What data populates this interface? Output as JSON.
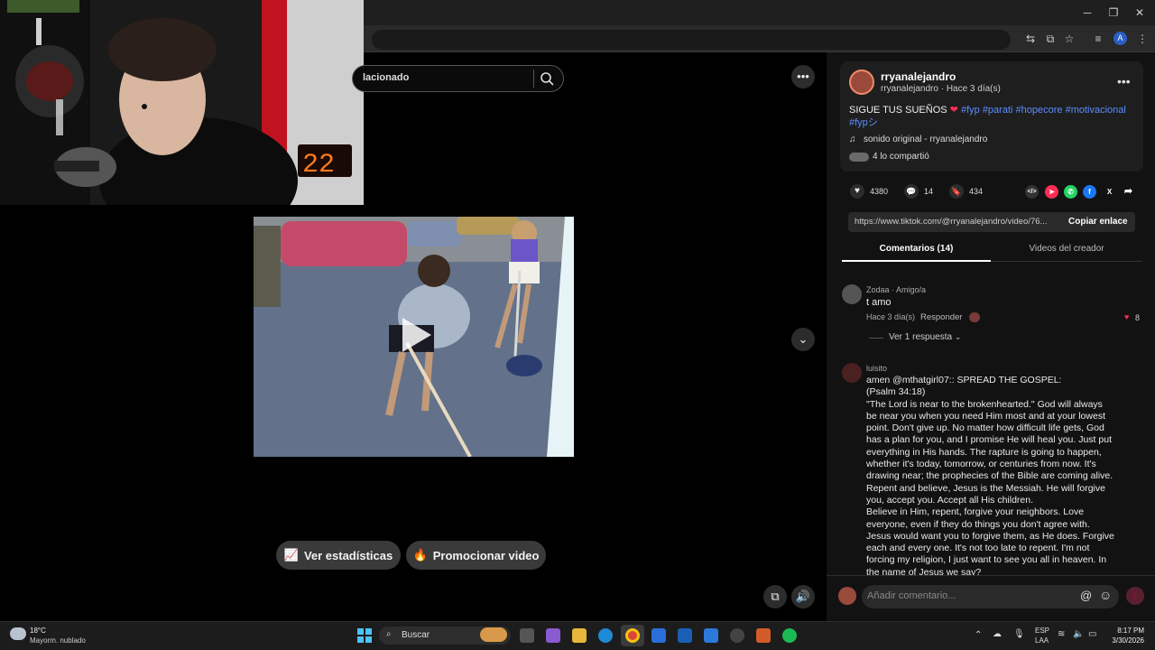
{
  "browser": {
    "window_controls": {
      "minimize": "─",
      "maximize": "❐",
      "close": "✕"
    },
    "profile_initial": "A"
  },
  "webcam": {
    "counter": "22"
  },
  "search": {
    "value": "lacionado"
  },
  "video_actions": {
    "stats_label": "Ver estadísticas",
    "promote_label": "Promocionar video"
  },
  "post": {
    "username": "rryanalejandro",
    "subline": "rryanalejandro · Hace 3 día(s)",
    "caption_text": "SIGUE TUS SUEÑOS",
    "hashtags": [
      "#fyp",
      "#parati",
      "#hopecore",
      "#motivacional",
      "#fypシ"
    ],
    "sound": "sonido original - rryanalejandro",
    "shared": "4 lo compartió"
  },
  "stats": {
    "likes": "4380",
    "comments": "14",
    "saves": "434"
  },
  "link": {
    "url": "https://www.tiktok.com/@rryanalejandro/video/76...",
    "copy_label": "Copiar enlace"
  },
  "tabs": [
    {
      "label": "Comentarios (14)",
      "active": true
    },
    {
      "label": "Videos del creador",
      "active": false
    }
  ],
  "comments": [
    {
      "user": "Zodaa",
      "badge": "Amigo/a",
      "user_line": "Zodaa · Amigo/a",
      "text": "t amo",
      "time": "Hace 3 día(s)",
      "reply_label": "Responder",
      "likes": "8",
      "view_replies": "Ver 1 respuesta"
    },
    {
      "user": "luisito",
      "lines": [
        "amen @mthatgirl07:: SPREAD THE GOSPEL:",
        "(Psalm 34:18)",
        "\"The Lord is near to the brokenhearted.\" God will always",
        "be near you when you need Him most and at your lowest",
        "point. Don't give up. No matter how difficult life gets, God",
        "has a plan for you, and I promise He will heal you. Just put",
        "everything in His hands. The rapture is going to happen,",
        "whether it's today, tomorrow, or centuries from now. It's",
        "drawing near; the prophecies of the Bible are coming alive.",
        "Repent and believe, Jesus is the Messiah. He will forgive",
        "you, accept you. Accept all His children.",
        "Believe in Him, repent, forgive your neighbors. Love",
        "everyone, even if they do things you don't agree with.",
        "Jesus would want you to forgive them, as He does. Forgive",
        "each and every one. It's not too late to repent. I'm not",
        "forcing my religion, I just want to see you all in heaven. In",
        "the name of Jesus we say?"
      ]
    }
  ],
  "comment_input": {
    "placeholder": "Añadir comentario..."
  },
  "taskbar": {
    "weather_temp": "18°C",
    "weather_desc": "Mayorm. nublado",
    "search_label": "Buscar",
    "lang_1": "ESP",
    "lang_2": "LAA",
    "time": "8:17 PM",
    "date": "3/30/2026"
  },
  "colors": {
    "accent_blue": "#5b8cff",
    "heart": "#fe2c55",
    "panel_bg": "#121212",
    "card_bg": "#1e1e1e"
  }
}
